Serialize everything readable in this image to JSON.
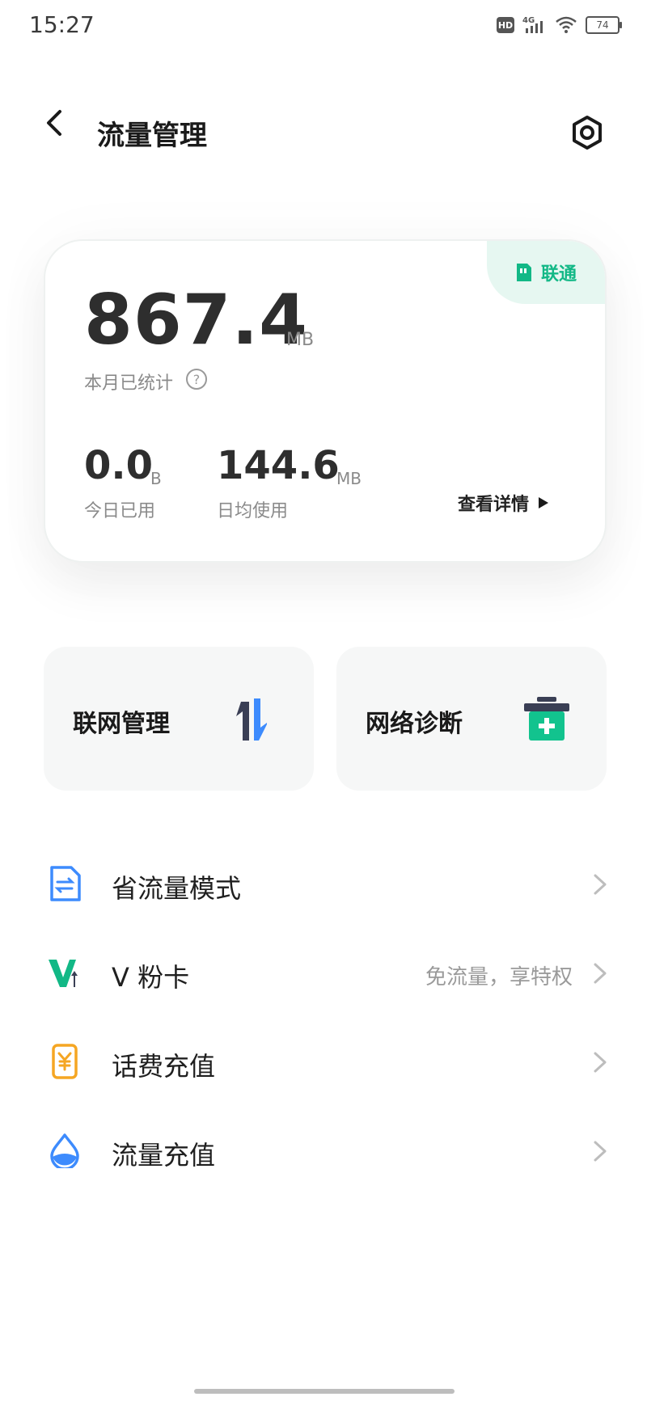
{
  "status_bar": {
    "time": "15:27",
    "hd": "HD",
    "network": "4G",
    "battery": "74"
  },
  "header": {
    "title": "流量管理"
  },
  "usage_card": {
    "carrier": "联通",
    "monthly_value": "867.4",
    "monthly_unit": "MB",
    "monthly_label": "本月已统计",
    "today_value": "0.0",
    "today_unit": "B",
    "today_label": "今日已用",
    "daily_avg_value": "144.6",
    "daily_avg_unit": "MB",
    "daily_avg_label": "日均使用",
    "detail_link": "查看详情"
  },
  "tiles": [
    {
      "label": "联网管理",
      "icon": "updown-arrows-icon"
    },
    {
      "label": "网络诊断",
      "icon": "first-aid-kit-icon"
    }
  ],
  "list": [
    {
      "label": "省流量模式",
      "subtext": "",
      "icon": "document-swap-icon",
      "color": "#3d8bfd"
    },
    {
      "label": "V 粉卡",
      "subtext": "免流量，享特权",
      "icon": "v-card-icon",
      "color": "#12b886"
    },
    {
      "label": "话费充值",
      "subtext": "",
      "icon": "yuan-phone-icon",
      "color": "#f5a623"
    },
    {
      "label": "流量充值",
      "subtext": "",
      "icon": "water-drop-icon",
      "color": "#3d8bfd"
    }
  ],
  "colors": {
    "accent_green": "#12b886",
    "accent_blue": "#3d8bfd",
    "accent_orange": "#f5a623",
    "tile_bg": "#f6f7f7"
  }
}
